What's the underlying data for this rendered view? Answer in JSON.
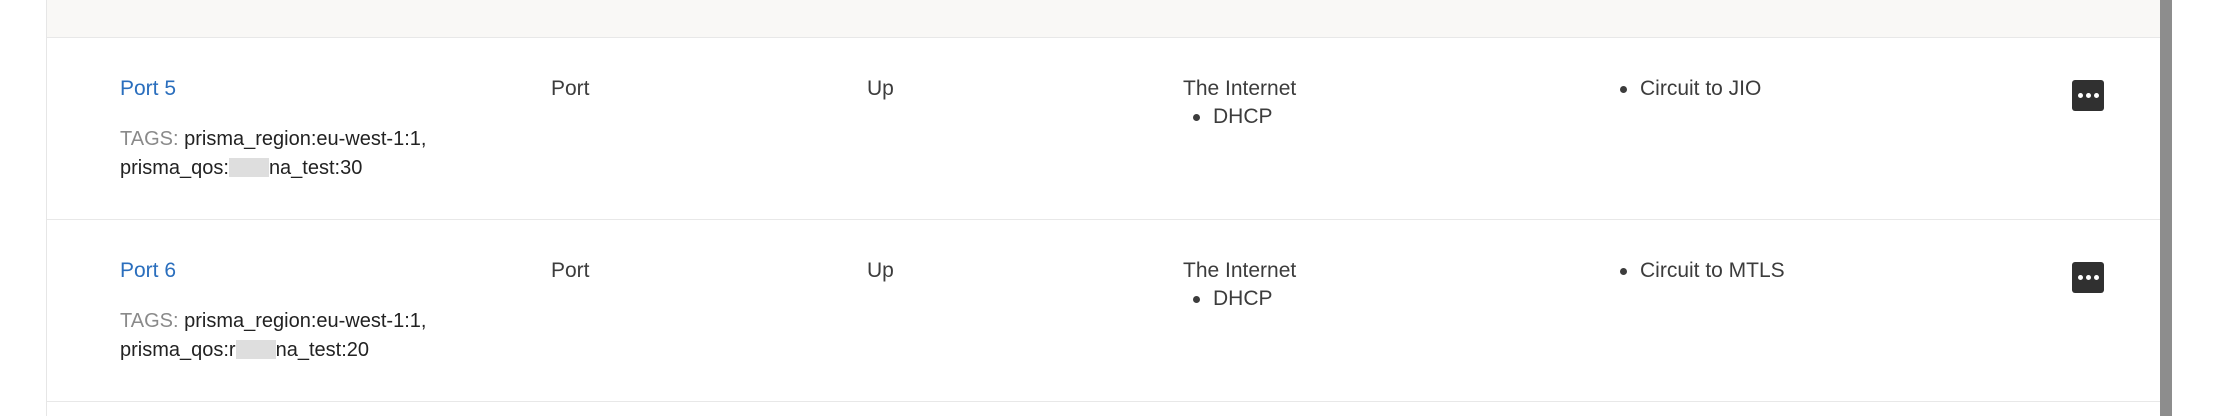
{
  "rows": [
    {
      "name": "Port 5",
      "tags_label": "TAGS:",
      "tags_line1": "prisma_region:eu-west-1:1,",
      "tags_line2_prefix": "prisma_qos:",
      "tags_line2_suffix": "na_test:30",
      "type": "Port",
      "status": "Up",
      "network_name": "The Internet",
      "network_items": [
        "DHCP"
      ],
      "circuits": [
        "Circuit to JIO"
      ],
      "action_icon": "ellipsis-icon"
    },
    {
      "name": "Port 6",
      "tags_label": "TAGS:",
      "tags_line1": "prisma_region:eu-west-1:1,",
      "tags_line2_prefix": "prisma_qos:r",
      "tags_line2_suffix": "na_test:20",
      "type": "Port",
      "status": "Up",
      "network_name": "The Internet",
      "network_items": [
        "DHCP"
      ],
      "circuits": [
        "Circuit to MTLS"
      ],
      "action_icon": "ellipsis-icon"
    }
  ],
  "colors": {
    "link": "#2a6ebd",
    "text": "#3c3c3c",
    "tag_label": "#8a8a8a",
    "button": "#303030",
    "header_bg": "#f9f8f6",
    "scrollbar": "#8d8d8d"
  }
}
